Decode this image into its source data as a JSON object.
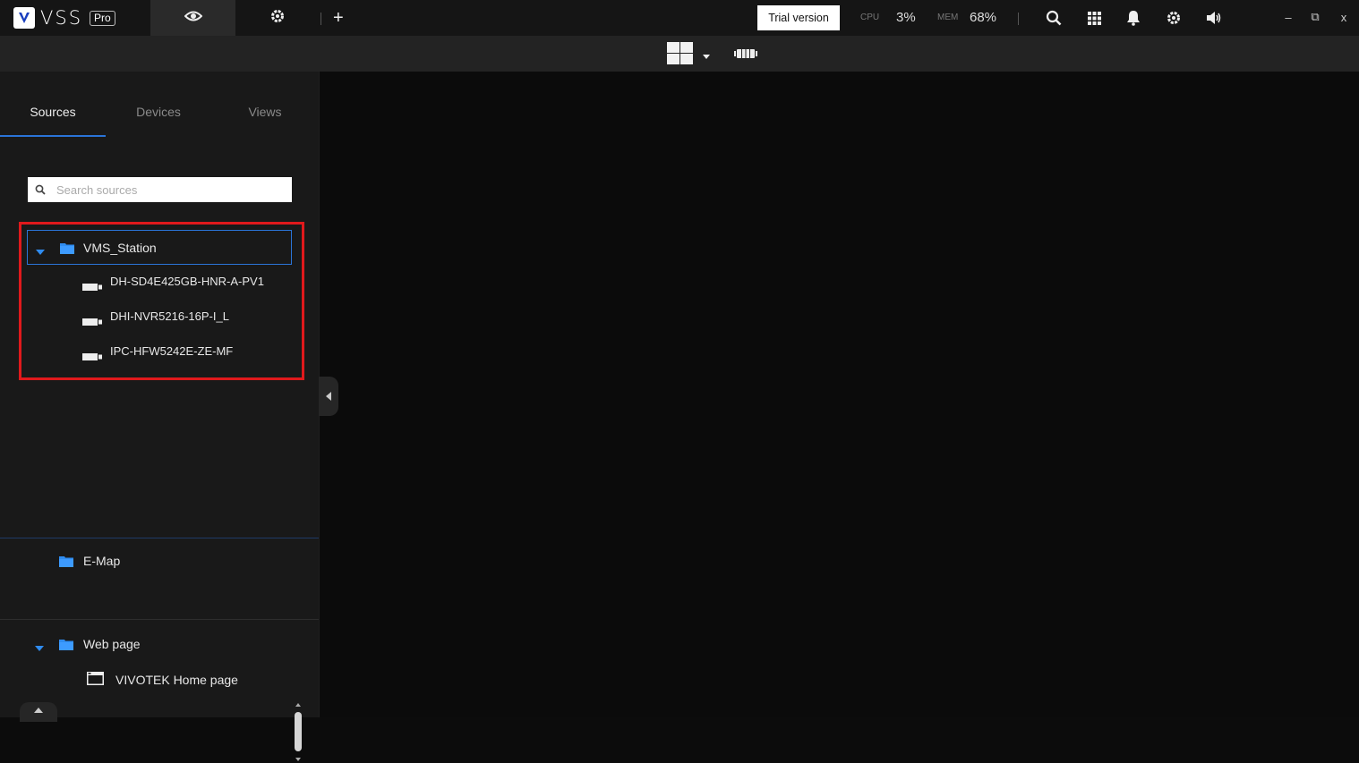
{
  "app": {
    "logo_letter": "V",
    "name": "VSS",
    "badge": "Pro"
  },
  "topbar": {
    "trial_label": "Trial version",
    "cpu_label": "CPU",
    "cpu_value": "3%",
    "mem_label": "MEM",
    "mem_value": "68%",
    "add_tab": "+",
    "icons": [
      "eye-icon",
      "gear-icon",
      "search-icon",
      "apps-grid-icon",
      "bell-icon",
      "settings-gear-icon",
      "speaker-icon"
    ],
    "window_controls": {
      "minimize": "–",
      "restore": "⧉",
      "close": "x"
    }
  },
  "sidebar": {
    "tabs": [
      {
        "label": "Sources",
        "active": true
      },
      {
        "label": "Devices",
        "active": false
      },
      {
        "label": "Views",
        "active": false
      }
    ],
    "search_placeholder": "Search sources",
    "station": {
      "label": "VMS_Station",
      "devices": [
        {
          "label": "DH-SD4E425GB-HNR-A-PV1"
        },
        {
          "label": "DHI-NVR5216-16P-I_L"
        },
        {
          "label": "IPC-HFW5242E-ZE-MF"
        }
      ]
    },
    "emap": {
      "label": "E-Map"
    },
    "webpage": {
      "label": "Web page",
      "items": [
        {
          "label": "VIVOTEK Home page"
        }
      ]
    }
  },
  "colors": {
    "accent": "#2a74d8",
    "folder": "#2f8cf0",
    "highlight": "#e0191c",
    "panel_bg": "#191919",
    "toolbar_bg": "#232323",
    "topbar_bg": "#151515"
  }
}
